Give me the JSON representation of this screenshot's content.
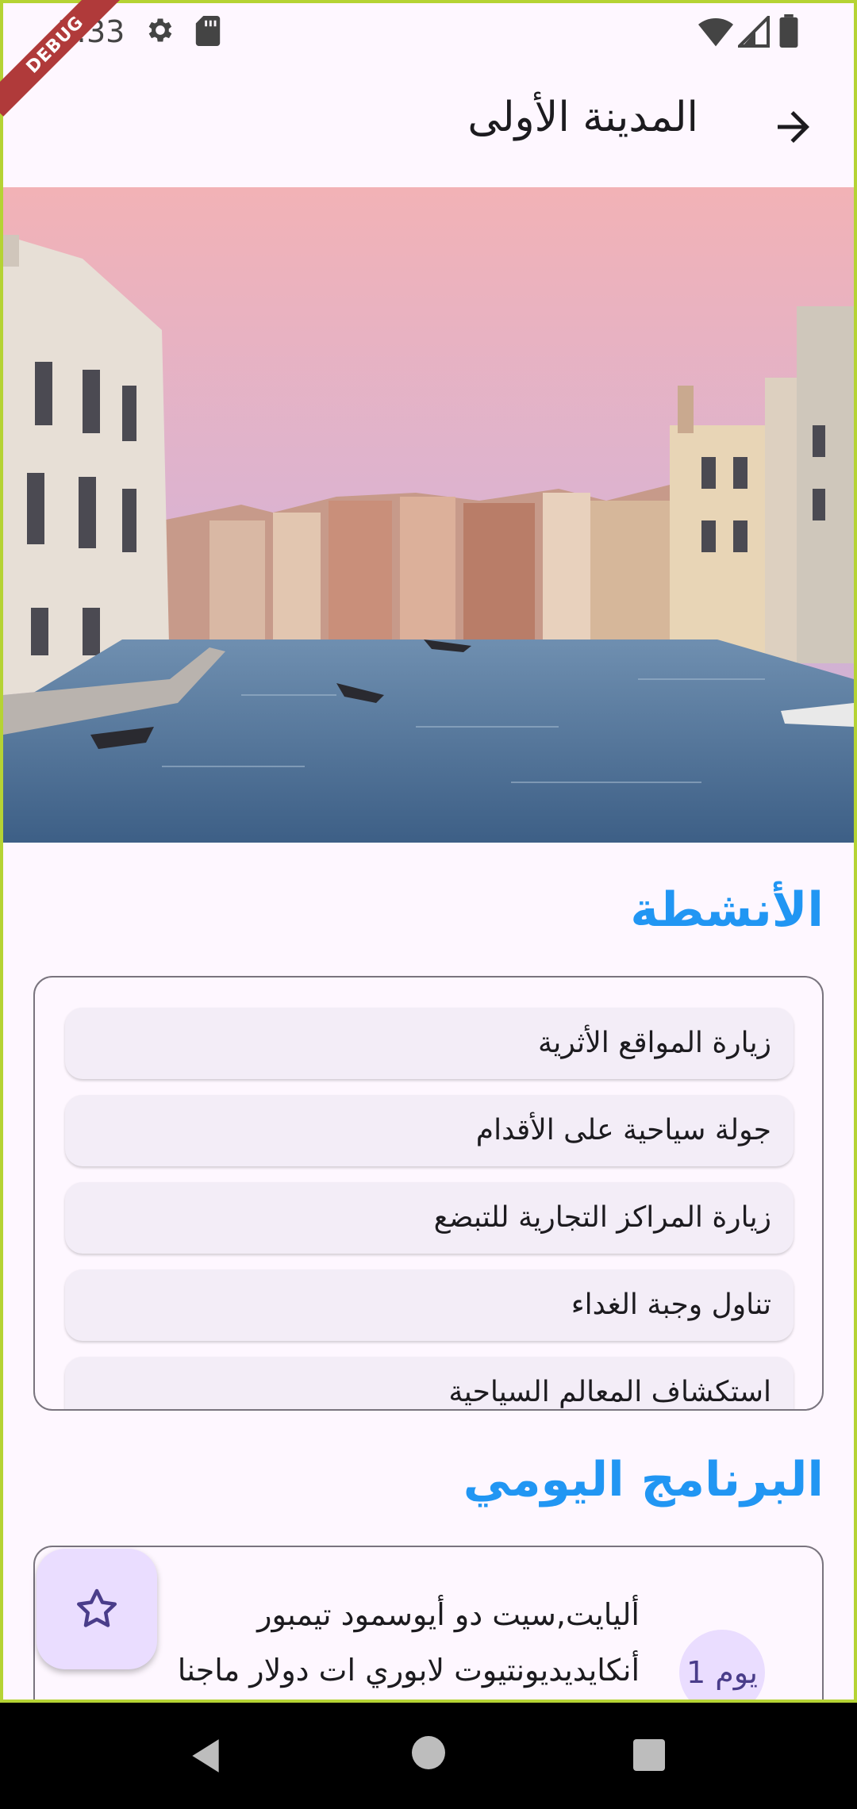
{
  "status_bar": {
    "time": "3:33",
    "debug_label": "DEBUG",
    "icons": [
      "gear-icon",
      "sd-card-icon",
      "wifi-icon",
      "signal-icon",
      "battery-icon"
    ]
  },
  "app_bar": {
    "title": "المدينة الأولى",
    "back_icon": "arrow-forward-icon"
  },
  "hero_image": {
    "alt": "Venice canal at sunset"
  },
  "activities": {
    "heading": "الأنشطة",
    "items": [
      "زيارة المواقع الأثرية",
      "جولة سياحية على الأقدام",
      "زيارة المراكز التجارية للتبضع",
      "تناول وجبة الغداء",
      "استكشاف المعالم السياحية"
    ]
  },
  "daily_program": {
    "heading": "البرنامج اليومي",
    "day_label": "يوم 1",
    "line1": "أليايت,سيت دو أيوسمود تيمبور",
    "line2": "أنكايديديونتيوت لابوري ات دولار ماجنا"
  },
  "fab": {
    "icon": "star-outline-icon"
  },
  "colors": {
    "accent": "#2196f3",
    "background": "#fef7ff",
    "chip": "#f3edf7",
    "fab": "#eaddff",
    "frame": "#b5d334"
  }
}
